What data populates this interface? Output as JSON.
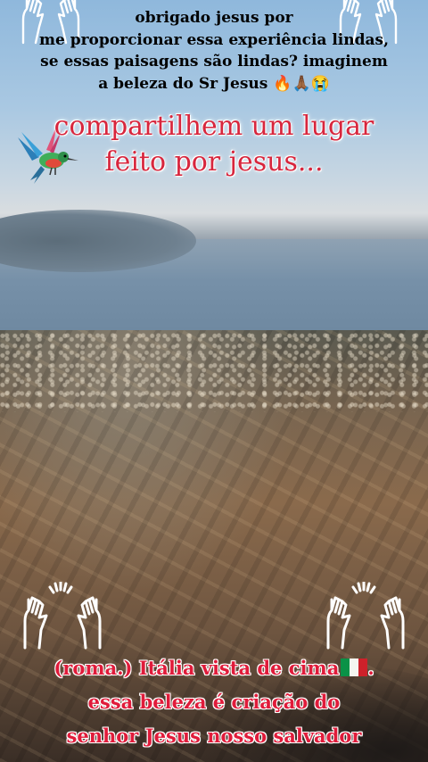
{
  "caption_top": {
    "lines": [
      "obrigado  jesus  por",
      "me  proporcionar  essa  experiência lindas,",
      "se  essas  paisagens  são  lindas? imaginem",
      "a  beleza  do  Sr Jesus 🔥🙏🏾😭"
    ]
  },
  "title": {
    "lines": [
      "compartilhem  um  lugar",
      "feito  por  jesus..."
    ]
  },
  "caption_bottom": {
    "line1": "(roma.) Itália  vista  de  cima",
    "line2": "essa  beleza  é  criação  do",
    "line3": "senhor  Jesus  nosso  salvador",
    "line1_end": "."
  },
  "icons": {
    "top_left": "raised-hands-outline-icon",
    "top_right": "raised-hands-outline-icon",
    "bottom_left": "raised-hands-outline-icon",
    "bottom_right": "raised-hands-outline-icon",
    "bird": "hummingbird-icon",
    "flag": "italy-flag-icon"
  },
  "colors": {
    "title": "#d7263d",
    "caption_bottom": "#e01b3a",
    "caption_top": "#000000"
  }
}
